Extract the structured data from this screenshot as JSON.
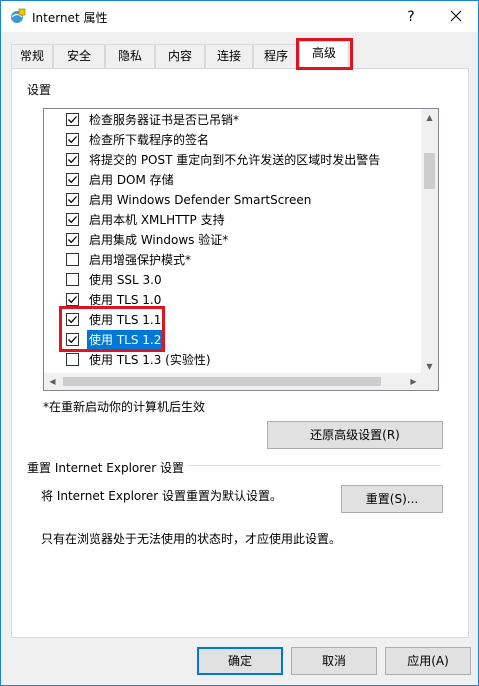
{
  "window": {
    "title": "Internet 属性",
    "help_glyph": "?",
    "close_glyph": "✕"
  },
  "tabs": [
    {
      "label": "常规"
    },
    {
      "label": "安全"
    },
    {
      "label": "隐私"
    },
    {
      "label": "内容"
    },
    {
      "label": "连接"
    },
    {
      "label": "程序"
    },
    {
      "label": "高级"
    }
  ],
  "active_tab": "高级",
  "settings": {
    "group_label": "设置",
    "items": [
      {
        "label": "检查服务器证书是否已吊销*",
        "checked": true,
        "selected": false
      },
      {
        "label": "检查所下载程序的签名",
        "checked": true,
        "selected": false
      },
      {
        "label": "将提交的 POST 重定向到不允许发送的区域时发出警告",
        "checked": true,
        "selected": false
      },
      {
        "label": "启用 DOM 存储",
        "checked": true,
        "selected": false
      },
      {
        "label": "启用 Windows Defender SmartScreen",
        "checked": true,
        "selected": false
      },
      {
        "label": "启用本机 XMLHTTP 支持",
        "checked": true,
        "selected": false
      },
      {
        "label": "启用集成 Windows 验证*",
        "checked": true,
        "selected": false
      },
      {
        "label": "启用增强保护模式*",
        "checked": false,
        "selected": false
      },
      {
        "label": "使用 SSL 3.0",
        "checked": false,
        "selected": false
      },
      {
        "label": "使用 TLS 1.0",
        "checked": true,
        "selected": false
      },
      {
        "label": "使用 TLS 1.1",
        "checked": true,
        "selected": false
      },
      {
        "label": "使用 TLS 1.2",
        "checked": true,
        "selected": true
      },
      {
        "label": "使用 TLS 1.3 (实验性)",
        "checked": false,
        "selected": false
      }
    ],
    "restart_note": "*在重新启动你的计算机后生效",
    "restore_button": "还原高级设置(R)"
  },
  "reset": {
    "group_label": "重置 Internet Explorer 设置",
    "description": "将 Internet Explorer 设置重置为默认设置。",
    "button": "重置(S)...",
    "note": "只有在浏览器处于无法使用的状态时，才应使用此设置。"
  },
  "footer": {
    "ok": "确定",
    "cancel": "取消",
    "apply": "应用(A)"
  },
  "colors": {
    "accent": "#0078d7",
    "highlight_border": "#e0141e"
  }
}
